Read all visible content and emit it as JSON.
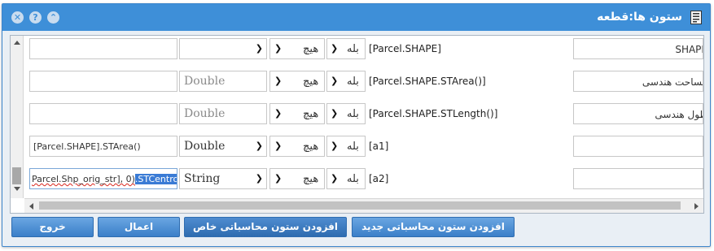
{
  "window": {
    "title": "ستون ها:قطعه",
    "title_icon": "document-list-icon",
    "controls": [
      {
        "name": "minimize-button",
        "glyph": "⌃"
      },
      {
        "name": "help-button",
        "glyph": "?"
      },
      {
        "name": "close-button",
        "glyph": "✕"
      }
    ]
  },
  "rows": [
    {
      "expression": "",
      "type": "",
      "calc": "هیچ",
      "visible": "بله",
      "field": "[Parcel.SHAPE]",
      "alias": "SHAPE"
    },
    {
      "expression": "",
      "type": "Double",
      "calc": "هیچ",
      "visible": "بله",
      "field": "[Parcel.SHAPE.STArea()]",
      "alias": "مساحت هندسی"
    },
    {
      "expression": "",
      "type": "Double",
      "calc": "هیچ",
      "visible": "بله",
      "field": "[Parcel.SHAPE.STLength()]",
      "alias": "طول هندسی"
    },
    {
      "expression": "[Parcel.SHAPE].STArea()",
      "type": "Double",
      "calc": "هیچ",
      "visible": "بله",
      "field": "[a1]",
      "alias": ""
    },
    {
      "expression_prefix": "Parcel.Shp_orig_str], 0)",
      "expression_selected": ".STCentroid()",
      "type": "String",
      "calc": "هیچ",
      "visible": "بله",
      "field": "[a2]",
      "alias": ""
    }
  ],
  "buttons": {
    "add_computed": "افزودن ستون محاسباتی جدید",
    "add_special": "افزودن ستون محاسباتی خاص",
    "apply": "اعمال",
    "exit": "خروج"
  },
  "colors": {
    "titlebar": "#3e8fd8",
    "button": "#3b7fc8",
    "selection": "#3a7bd5"
  }
}
